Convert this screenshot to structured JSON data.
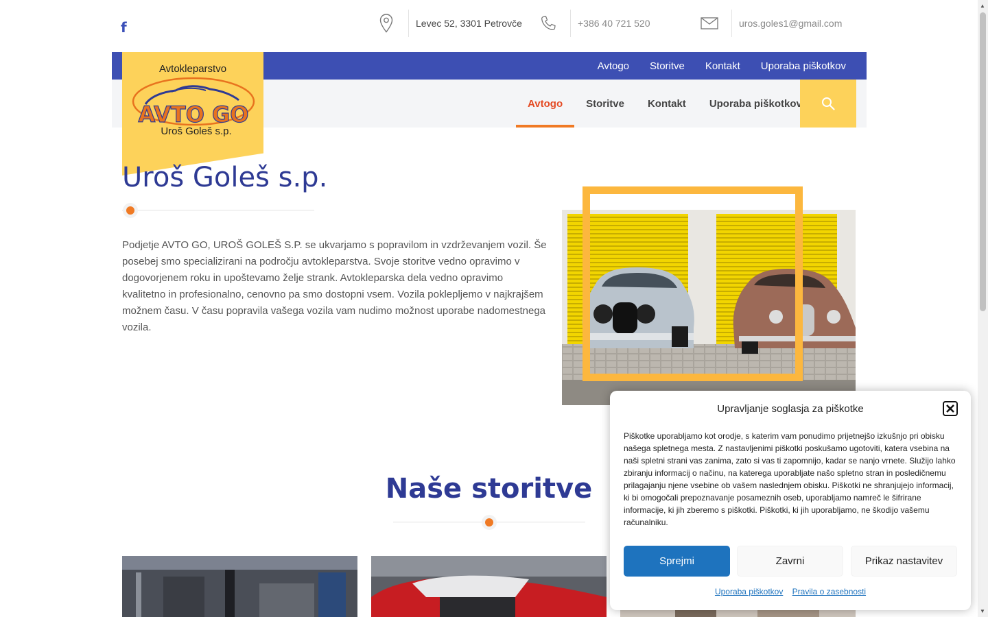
{
  "topbar": {
    "address": "Levec 52, 3301 Petrovče",
    "phone": "+386 40 721 520",
    "email": "uros.goles1@gmail.com"
  },
  "topnav": [
    "Avtogo",
    "Storitve",
    "Kontakt",
    "Uporaba piškotkov"
  ],
  "mainnav": {
    "items": [
      "Avtogo",
      "Storitve",
      "Kontakt",
      "Uporaba piškotkov"
    ],
    "active": "Avtogo"
  },
  "logo": {
    "top_text": "Avtokleparstvo",
    "brand": "AVTO GO",
    "bottom_text": "Uroš Goleš s.p."
  },
  "hero": {
    "title": "Uroš Goleš s.p.",
    "text": "Podjetje AVTO GO, UROŠ GOLEŠ S.P. se ukvarjamo s popravilom in vzdrževanjem vozil. Še posebej smo specializirani na področju avtokleparstva. Svoje storitve vedno opravimo v dogovorjenem roku in upoštevamo želje strank. Avtokleparska dela vedno opravimo kvalitetno in profesionalno, cenovno pa smo dostopni vsem. Vozila poklepljemo v najkrajšem možnem času. V času popravila vašega vozila vam nudimo možnost uporabe nadomestnega vozila."
  },
  "services": {
    "title": "Naše storitve"
  },
  "cookie": {
    "title": "Upravljanje soglasja za piškotke",
    "body": "Piškotke uporabljamo kot orodje, s katerim vam ponudimo prijetnejšo izkušnjo pri obisku našega spletnega mesta. Z nastavljenimi piškotki poskušamo ugotoviti, katera vsebina na naši spletni strani vas zanima, zato si vas ti zapomnijo, kadar se nanjo vrnete. Služijo lahko zbiranju informacij o načinu, na katerega uporabljate našo spletno stran in posledičnemu prilagajanju njene vsebine ob vašem naslednjem obisku. Piškotki ne shranjujejo informacij, ki bi omogočali prepoznavanje posameznih oseb, uporabljamo namreč le šifrirane informacije, ki jih zberemo s piškotki. Piškotki, ki jih uporabljamo, ne škodijo vašemu računalniku.",
    "accept": "Sprejmi",
    "deny": "Zavrni",
    "preferences": "Prikaz nastavitev",
    "link_cookies": "Uporaba piškotkov",
    "link_privacy": "Pravila o zasebnosti"
  },
  "colors": {
    "brand_blue": "#3d4fb3",
    "title_blue": "#2e3a94",
    "accent_orange": "#f07a24",
    "logo_yellow": "#fdd25a",
    "frame_yellow": "#fcb73e",
    "button_blue": "#1e73be"
  },
  "icons": [
    "facebook-icon",
    "map-pin-icon",
    "phone-icon",
    "envelope-icon",
    "search-icon",
    "close-icon"
  ]
}
